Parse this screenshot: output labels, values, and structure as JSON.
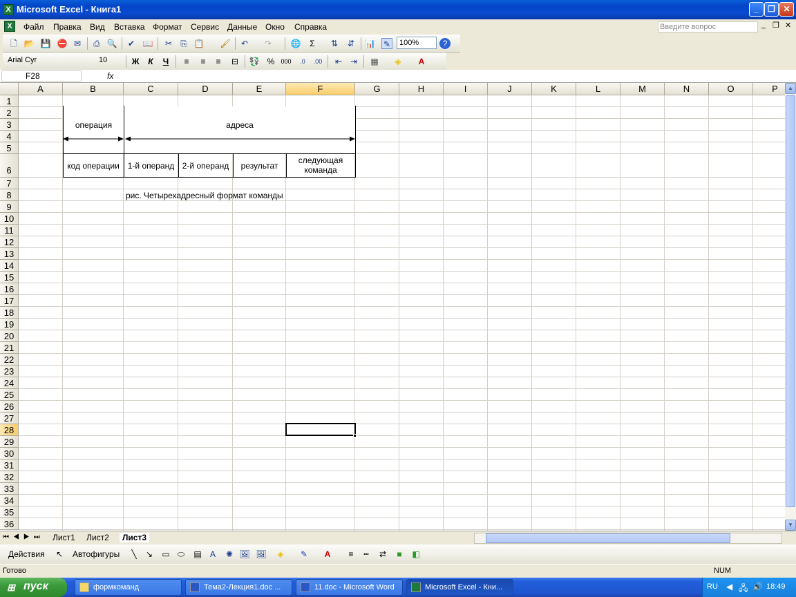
{
  "window": {
    "title": "Microsoft Excel - Книга1"
  },
  "menu": {
    "items": [
      "Файл",
      "Правка",
      "Вид",
      "Вставка",
      "Формат",
      "Сервис",
      "Данные",
      "Окно",
      "Справка"
    ],
    "help_placeholder": "Введите вопрос"
  },
  "toolbar": {
    "zoom": "100%",
    "font": "Arial Cyr",
    "size": "10",
    "bold": "Ж",
    "italic": "К",
    "underline": "Ч",
    "sum": "Σ",
    "percent": "%",
    "thousands": "000"
  },
  "formula": {
    "namebox": "F28",
    "fx": "fx",
    "value": ""
  },
  "columns": [
    "A",
    "B",
    "C",
    "D",
    "E",
    "F",
    "G",
    "H",
    "I",
    "J",
    "K",
    "L",
    "M",
    "N",
    "O",
    "P"
  ],
  "rows": [
    "1",
    "2",
    "3",
    "4",
    "5",
    "6",
    "7",
    "8",
    "9",
    "10",
    "11",
    "12",
    "13",
    "14",
    "15",
    "16",
    "17",
    "18",
    "19",
    "20",
    "21",
    "22",
    "23",
    "24",
    "25",
    "26",
    "27",
    "28",
    "29",
    "30",
    "31",
    "32",
    "33",
    "34",
    "35",
    "36"
  ],
  "cells": {
    "op": "операция",
    "addr": "адреса",
    "code": "код операции",
    "op1": "1-й операнд",
    "op2": "2-й операнд",
    "res": "результат",
    "next": "следующая команда",
    "caption": "рис. Четырехадресный формат команды"
  },
  "sheets": [
    "Лист1",
    "Лист2",
    "Лист3"
  ],
  "draw": {
    "actions": "Действия",
    "autoshapes": "Автофигуры"
  },
  "status": {
    "ready": "Готово",
    "num": "NUM"
  },
  "taskbar": {
    "start": "пуск",
    "tasks": [
      "формкоманд",
      "Тема2-Лекция1.doc ...",
      "11.doc - Microsoft Word",
      "Microsoft Excel - Кни..."
    ],
    "lang": "RU",
    "time": "18:49"
  },
  "colors": {
    "accent": "#0a4ad0",
    "selected_header": "#f9cd6b"
  }
}
